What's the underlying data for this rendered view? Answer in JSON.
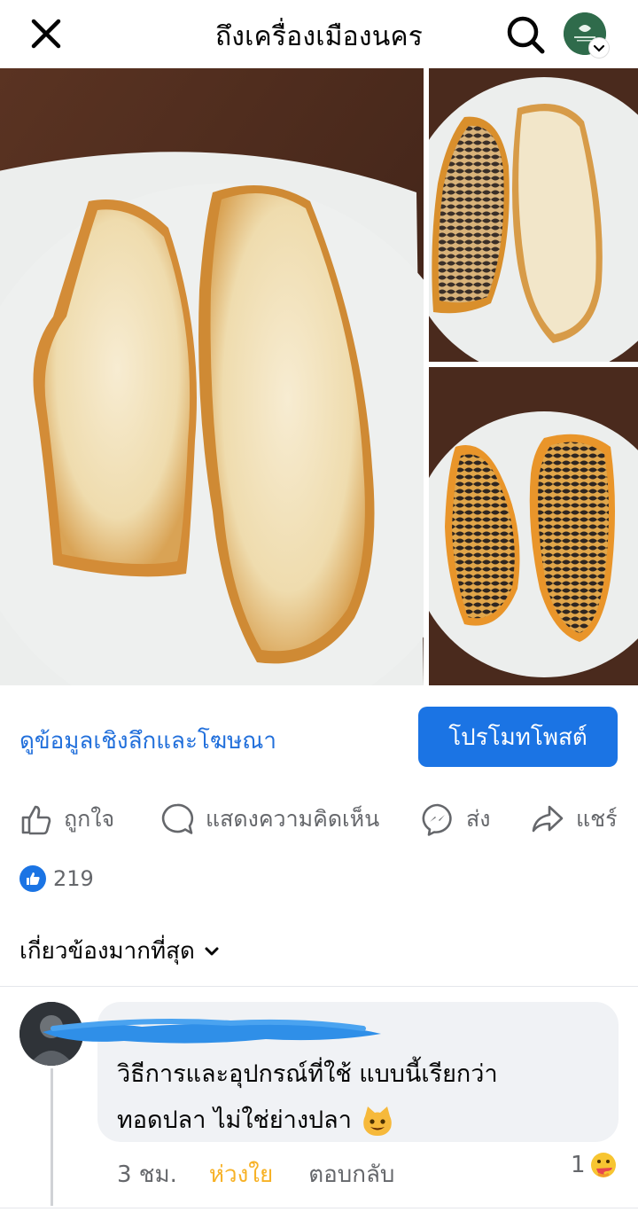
{
  "header": {
    "title": "ถึงเครื่องเมืองนคร",
    "close_icon": "close-icon",
    "search_icon": "search-icon",
    "avatar_icon": "page-avatar"
  },
  "photos": {
    "count": 3,
    "descriptions": [
      "fish-fillet-white-side",
      "fish-fillet-mixed",
      "fish-fillet-skin-side"
    ]
  },
  "post_bar": {
    "insights_link": "ดูข้อมูลเชิงลึกและโฆษณา",
    "promote_button": "โปรโมทโพสต์"
  },
  "actions": {
    "like": "ถูกใจ",
    "comment": "แสดงความคิดเห็น",
    "send": "ส่ง",
    "share": "แชร์"
  },
  "reactions": {
    "count": "219"
  },
  "sort": {
    "label": "เกี่ยวข้องมากที่สุด"
  },
  "comment": {
    "line1": "วิธีการและอุปกรณ์ที่ใช้ แบบนี้เรียกว่า",
    "line2": "ทอดปลา ไม่ใช่ย่างปลา",
    "time": "3 ชม.",
    "reaction_label": "ห่วงใย",
    "reply_label": "ตอบกลับ",
    "reaction_count": "1"
  },
  "colors": {
    "accent": "#1b74e4",
    "link": "#216fdb",
    "care": "#f7b125",
    "muted": "#65676b"
  }
}
